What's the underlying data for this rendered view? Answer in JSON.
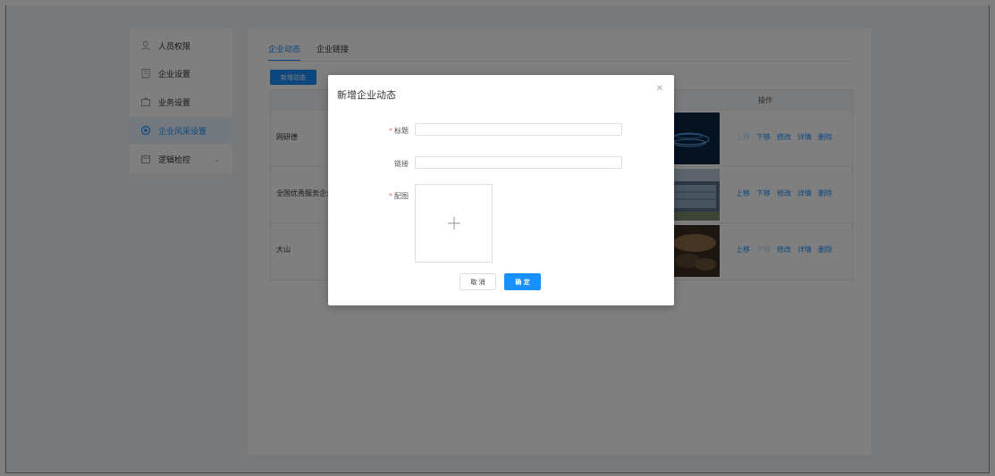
{
  "sidebar": {
    "items": [
      {
        "label": "人员权限",
        "icon": "user-icon"
      },
      {
        "label": "企业设置",
        "icon": "building-icon"
      },
      {
        "label": "业务设置",
        "icon": "briefcase-icon"
      },
      {
        "label": "企业风采设置",
        "icon": "target-icon",
        "active": true
      },
      {
        "label": "逻辑检控",
        "icon": "calendar-icon"
      }
    ]
  },
  "main": {
    "tabs": [
      {
        "label": "企业动态",
        "active": true
      },
      {
        "label": "企业链接"
      }
    ],
    "add_button": "新增动态",
    "table": {
      "op_header": "操作",
      "rows": [
        {
          "title": "网研德",
          "ops": [
            "上移",
            "下移",
            "修改",
            "详情",
            "删除"
          ],
          "disabled": [
            0
          ]
        },
        {
          "title": "全国优秀服务企业",
          "ops": [
            "上移",
            "下移",
            "修改",
            "详情",
            "删除"
          ],
          "disabled": []
        },
        {
          "title": "大山",
          "ops": [
            "上移",
            "下移",
            "修改",
            "详情",
            "删除"
          ],
          "disabled": [
            1
          ]
        }
      ]
    }
  },
  "modal": {
    "title": "新增企业动态",
    "fields": {
      "title_label": "标题",
      "link_label": "链接",
      "image_label": "配图",
      "title_value": "",
      "link_value": ""
    },
    "cancel_label": "取 消",
    "confirm_label": "确 定"
  },
  "colors": {
    "accent": "#1890ff",
    "overlay": "rgba(0,0,0,0.5)",
    "required": "#f56c6c"
  }
}
